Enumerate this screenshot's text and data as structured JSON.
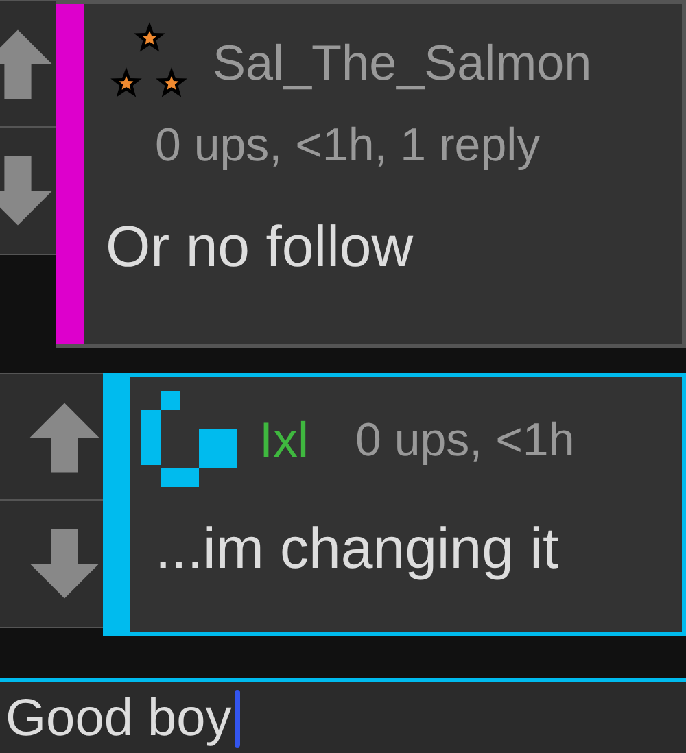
{
  "comments": [
    {
      "kind": "stars",
      "author": {
        "text": "Sal_The_Salmon",
        "color": "#999999"
      },
      "meta": "0 ups, <1h, 1 reply",
      "meta_inline": false,
      "body": "Or no follow",
      "color": "#dd00cc",
      "bordered": false
    },
    {
      "kind": "pixel",
      "author": {
        "text": "Ixl",
        "color": "#3fb83f"
      },
      "meta": "0 ups, <1h",
      "meta_inline": true,
      "body": "...im changing it",
      "color": "#00bbee",
      "bordered": true
    }
  ],
  "reply_box": {
    "value": "Good boy"
  }
}
